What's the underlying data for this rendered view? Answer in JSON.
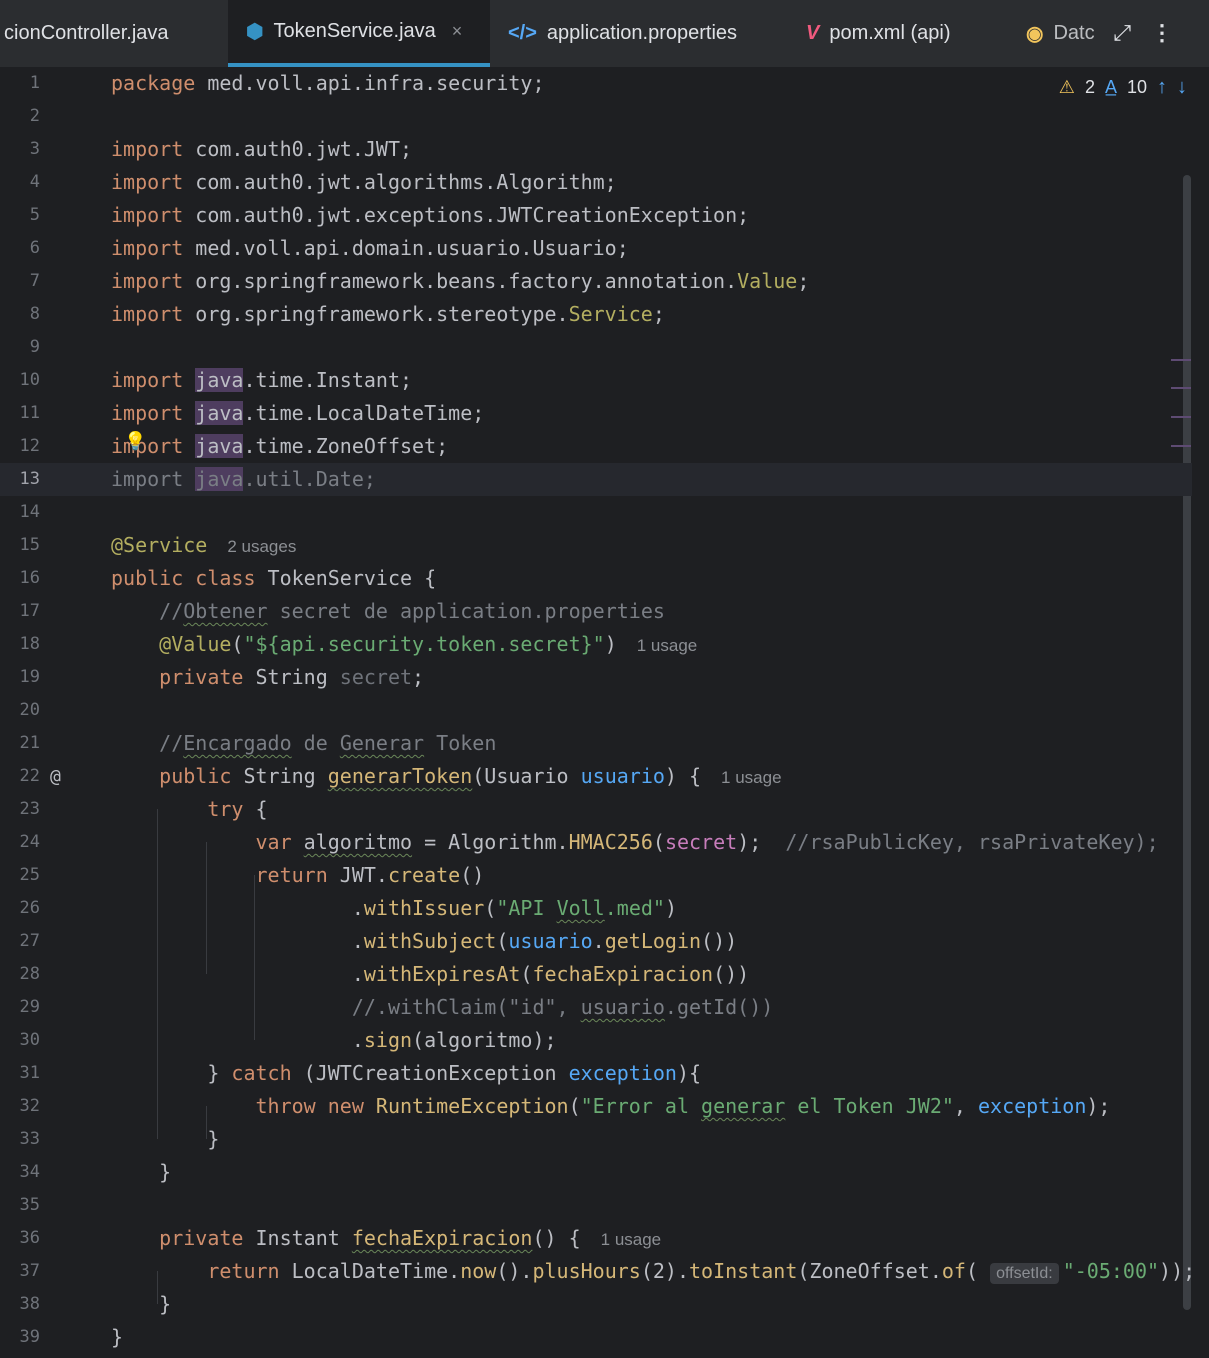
{
  "tabs": [
    {
      "label": "cionController.java",
      "icon": "java-class-icon",
      "active": false
    },
    {
      "label": "TokenService.java",
      "icon": "java-class-icon",
      "active": true,
      "close": "×"
    },
    {
      "label": "application.properties",
      "icon": "properties-code-icon",
      "active": false
    },
    {
      "label": "pom.xml (api)",
      "icon": "maven-icon",
      "active": false
    },
    {
      "label": "Datc",
      "icon": "spring-data-icon",
      "active": false
    }
  ],
  "toolbar": {
    "expand_icon": "expand-icon",
    "more_icon": "more-vertical-icon"
  },
  "inspections": {
    "warnings": "2",
    "typos": "10"
  },
  "colors": {
    "accent": "#3592c4",
    "background": "#1e1f22",
    "keyword": "#cf8e6d",
    "string": "#6aab73",
    "annotation": "#b3ae60"
  },
  "lines": [
    {
      "n": "1",
      "html": "<span class='kw'>package</span> med.voll.api.infra.security;"
    },
    {
      "n": "2",
      "html": ""
    },
    {
      "n": "3",
      "html": "<span class='kw'>import</span> com.auth0.jwt.JWT;"
    },
    {
      "n": "4",
      "html": "<span class='kw'>import</span> com.auth0.jwt.algorithms.Algorithm;"
    },
    {
      "n": "5",
      "html": "<span class='kw'>import</span> com.auth0.jwt.exceptions.JWTCreationException;"
    },
    {
      "n": "6",
      "html": "<span class='kw'>import</span> med.voll.api.domain.usuario.Usuario;"
    },
    {
      "n": "7",
      "html": "<span class='kw'>import</span> org.springframework.beans.factory.annotation.<span class='ann'>Value</span>;"
    },
    {
      "n": "8",
      "html": "<span class='kw'>import</span> org.springframework.stereotype.<span class='ann'>Service</span>;"
    },
    {
      "n": "9",
      "html": ""
    },
    {
      "n": "10",
      "html": "<span class='kw'>import</span> <span class='pkg'>java</span>.time.Instant;"
    },
    {
      "n": "11",
      "html": "<span class='kw'>import</span> <span class='pkg'>java</span>.time.LocalDateTime;"
    },
    {
      "n": "12",
      "html": "<span class='kw'>import</span> <span class='pkg'>java</span>.time.ZoneOffset;"
    },
    {
      "n": "13",
      "html": "<span class='unused'>import <span class='pkg'>java</span>.util.Date;</span>",
      "current": true
    },
    {
      "n": "14",
      "html": ""
    },
    {
      "n": "15",
      "html": "<span class='ann'>@Service</span><span class='usage'>2 usages</span>"
    },
    {
      "n": "16",
      "html": "<span class='kw'>public class</span> TokenService {"
    },
    {
      "n": "17",
      "html": "    <span class='cmt'>//<span class='ul'>Obtener</span> secret de application.properties</span>"
    },
    {
      "n": "18",
      "html": "    <span class='ann'>@Value</span>(<span class='str'>\"${api.security.token.secret}\"</span>)<span class='usage'>1 usage</span>"
    },
    {
      "n": "19",
      "html": "    <span class='kw'>private</span> String <span class='dim'>secret</span>;"
    },
    {
      "n": "20",
      "html": ""
    },
    {
      "n": "21",
      "html": "    <span class='cmt'>//<span class='ul'>Encargado</span> de <span class='ul'>Generar</span> Token</span>"
    },
    {
      "n": "22",
      "html": "    <span class='kw'>public</span> String <span class='met'><span class='ul'>generarToken</span></span>(Usuario <span class='par'>usuario</span>) {<span class='usage'>1 usage</span>",
      "gm": "@"
    },
    {
      "n": "23",
      "html": "        <span class='kw'>try</span> {"
    },
    {
      "n": "24",
      "html": "            <span class='kw'>var</span> <span class='ul'>algoritmo</span> = Algorithm.<span class='met'>HMAC256</span>(<span class='fld'>secret</span>);  <span class='cmt'>//rsaPublicKey, rsaPrivateKey);</span>"
    },
    {
      "n": "25",
      "html": "            <span class='kw'>return</span> JWT.<span class='met'>create</span>()"
    },
    {
      "n": "26",
      "html": "                    .<span class='met'>withIssuer</span>(<span class='str'>\"API <span class='ul'>Voll</span>.med\"</span>)"
    },
    {
      "n": "27",
      "html": "                    .<span class='met'>withSubject</span>(<span class='par'>usuario</span>.<span class='met'>getLogin</span>())"
    },
    {
      "n": "28",
      "html": "                    .<span class='met'>withExpiresAt</span>(<span class='met'>fechaExpiracion</span>())"
    },
    {
      "n": "29",
      "html": "                    <span class='cmt'>//.withClaim(\"id\", <span class='ul'>usuario</span>.getId())</span>"
    },
    {
      "n": "30",
      "html": "                    .<span class='met'>sign</span>(algoritmo);"
    },
    {
      "n": "31",
      "html": "        } <span class='kw'>catch</span> (JWTCreationException <span class='par'>exception</span>){"
    },
    {
      "n": "32",
      "html": "            <span class='kw'>throw new</span> <span class='met'>RuntimeException</span>(<span class='str'>\"Error al <span class='ul'>generar</span> el Token JW2\"</span>, <span class='par'>exception</span>);"
    },
    {
      "n": "33",
      "html": "        }"
    },
    {
      "n": "34",
      "html": "    }"
    },
    {
      "n": "35",
      "html": ""
    },
    {
      "n": "36",
      "html": "    <span class='kw'>private</span> Instant <span class='met'><span class='ul'>fechaExpiracion</span></span>() {<span class='usage'>1 usage</span>"
    },
    {
      "n": "37",
      "html": "        <span class='kw'>return</span> LocalDateTime.<span class='met'>now</span>().<span class='met'>plusHours</span>(2).<span class='met'>toInstant</span>(ZoneOffset.<span class='met'>of</span>( <span class='hint'>offsetId:</span><span class='str'>\"-05:00\"</span>));"
    },
    {
      "n": "38",
      "html": "    }"
    },
    {
      "n": "39",
      "html": "}"
    }
  ]
}
